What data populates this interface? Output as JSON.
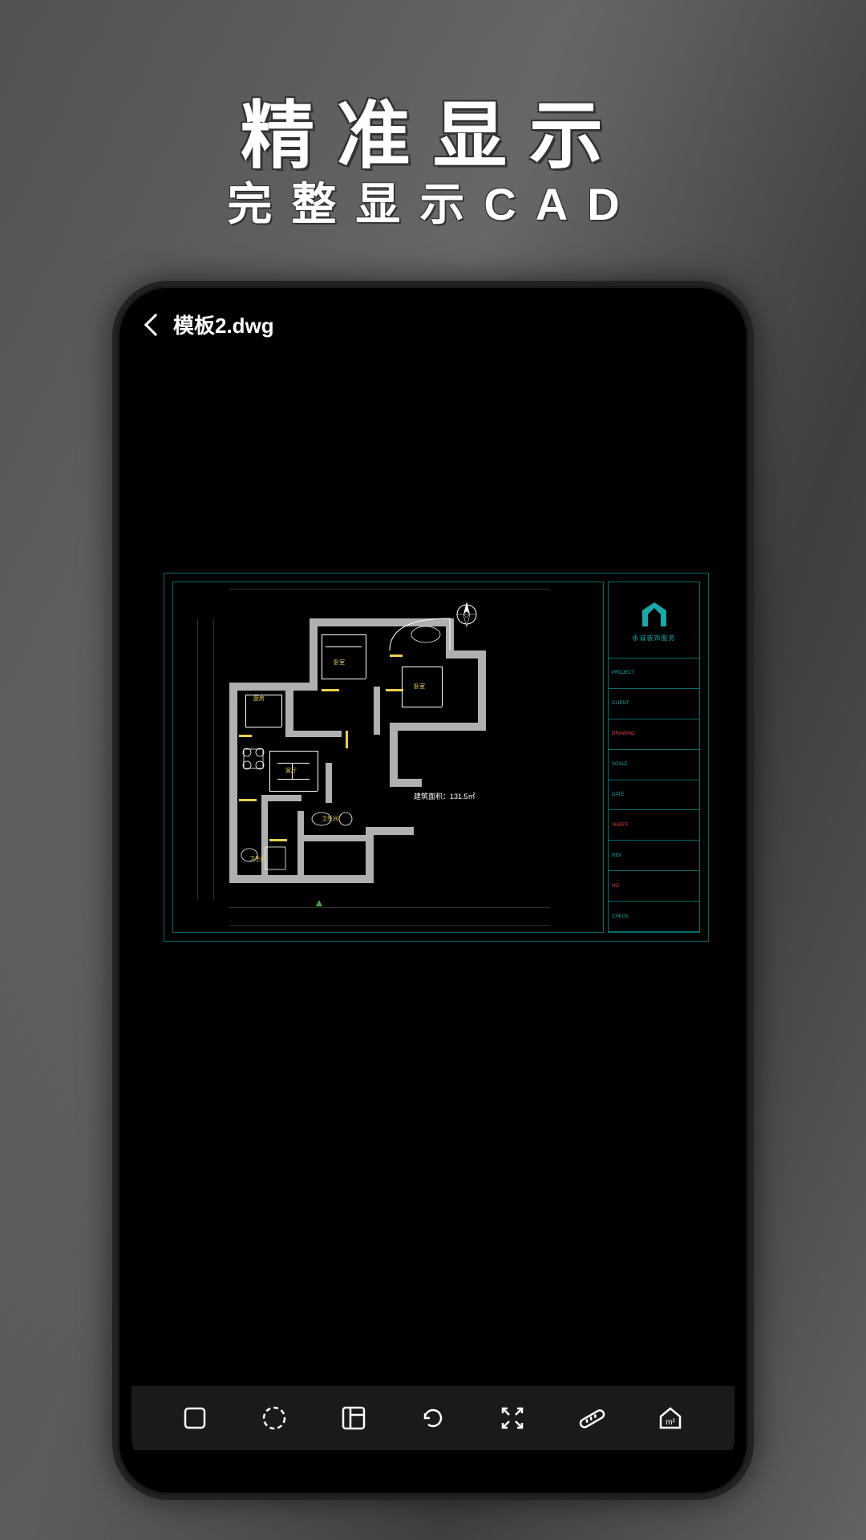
{
  "promo": {
    "headline": "精准显示",
    "subheadline": "完整显示CAD"
  },
  "app": {
    "file_name": "模板2.dwg",
    "brand_name": "永诚装饰服务",
    "area_label": "建筑面积：131.5㎡"
  },
  "toolbar": {
    "layers_label": "layers",
    "view_label": "view",
    "layout_label": "layout",
    "reset_label": "reset",
    "fullscreen_label": "fullscreen",
    "measure_label": "measure",
    "home_label": "home"
  }
}
